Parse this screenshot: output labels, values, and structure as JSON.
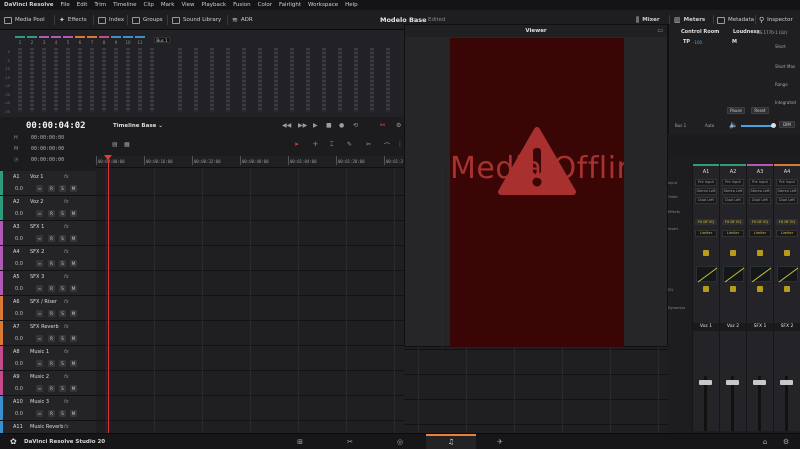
{
  "menu": [
    "DaVinci Resolve",
    "File",
    "Edit",
    "Trim",
    "Timeline",
    "Clip",
    "Mark",
    "View",
    "Playback",
    "Fusion",
    "Color",
    "Fairlight",
    "Workspace",
    "Help"
  ],
  "toolbar": {
    "media_pool": "Media Pool",
    "effects": "Effects",
    "index": "Index",
    "groups": "Groups",
    "sound_library": "Sound Library",
    "adr": "ADR",
    "mixer": "Mixer",
    "meters": "Meters",
    "metadata": "Metadata",
    "inspector": "Inspector"
  },
  "project": {
    "title": "Modelo Base",
    "state": "Edited"
  },
  "meter_bridge": {
    "channels": [
      "1",
      "2",
      "3",
      "4",
      "5",
      "6",
      "7",
      "8",
      "9",
      "10",
      "11"
    ],
    "channel_colors": [
      "#2e9c7c",
      "#2e9c7c",
      "#b05ab6",
      "#b05ab6",
      "#b05ab6",
      "#d87a34",
      "#d87a34",
      "#c44a8a",
      "#3a8fcf",
      "#3a8fcf",
      "#3a8fcf"
    ],
    "bus_label": "Bus 1",
    "scale": [
      "0",
      "-5",
      "-10",
      "-15",
      "-20",
      "-30",
      "-40",
      "-50"
    ]
  },
  "viewer": {
    "title": "Viewer",
    "offline_text": "Media Offline"
  },
  "control_room": {
    "title": "Control Room",
    "tp_label": "TP",
    "tp_value": "-100",
    "m_label": "M",
    "loudness_title": "Loudness",
    "standard": "BS.1770-1 (LU)",
    "short": "Short",
    "short_max": "Short Max",
    "range": "Range",
    "integrated": "Integrated",
    "pause": "Pause",
    "reset": "Reset",
    "bus": "Bus 1",
    "auto": "Auto",
    "dim": "DIM"
  },
  "transport": {
    "timecode": "00:00:04:02",
    "timeline_name": "Timeline Base",
    "sub_rows": [
      {
        "label": "H",
        "tc": "00:00:00:00"
      },
      {
        "label": "M",
        "tc": "00:00:00:00"
      },
      {
        "label": "◷",
        "tc": "00:00:00:00"
      }
    ]
  },
  "ruler": [
    "00:00:00:00",
    "00:00:16:00",
    "00:00:32:00",
    "00:00:48:00",
    "00:01:04:00",
    "00:01:20:00",
    "00:01:3"
  ],
  "tracks": [
    {
      "id": "A1",
      "name": "Voz 1",
      "color": "#2e9c7c",
      "vol": "0.0"
    },
    {
      "id": "A2",
      "name": "Voz 2",
      "color": "#2e9c7c",
      "vol": "0.0"
    },
    {
      "id": "A3",
      "name": "SFX 1",
      "color": "#b05ab6",
      "vol": "0.0"
    },
    {
      "id": "A4",
      "name": "SFX 2",
      "color": "#b05ab6",
      "vol": "0.0"
    },
    {
      "id": "A5",
      "name": "SFX 3",
      "color": "#b05ab6",
      "vol": "0.0"
    },
    {
      "id": "A6",
      "name": "SFX / Riser",
      "color": "#d87a34",
      "vol": "0.0"
    },
    {
      "id": "A7",
      "name": "SFX Reverb",
      "color": "#d87a34",
      "vol": "0.0"
    },
    {
      "id": "A8",
      "name": "Music 1",
      "color": "#c44a8a",
      "vol": "0.0"
    },
    {
      "id": "A9",
      "name": "Music 2",
      "color": "#c44a8a",
      "vol": "0.0"
    },
    {
      "id": "A10",
      "name": "Music 3",
      "color": "#3a8fcf",
      "vol": "0.0"
    },
    {
      "id": "A11",
      "name": "Music Reverb",
      "color": "#3a8fcf",
      "vol": ""
    }
  ],
  "track_fx": "fx",
  "track_btns": [
    "R",
    "S",
    "M"
  ],
  "mixer": {
    "channels": [
      {
        "label": "A1",
        "name": "Voz 1",
        "color": "#2e9c7c"
      },
      {
        "label": "A2",
        "name": "Voz 2",
        "color": "#2e9c7c"
      },
      {
        "label": "A3",
        "name": "SFX 1",
        "color": "#b05ab6"
      },
      {
        "label": "A4",
        "name": "SFX 2",
        "color": "#d87a34"
      }
    ],
    "input": "Pre Input",
    "stereo": "Stereo Left",
    "dual": "Dual Left",
    "limiter": "Limiter",
    "fx_row": "FX DF EQ",
    "row_labels": [
      "Input",
      "Order",
      "Effects",
      "Insert",
      "EQ",
      "Dynamics"
    ]
  },
  "bottom": {
    "brand": "DaVinci Resolve Studio 20"
  }
}
